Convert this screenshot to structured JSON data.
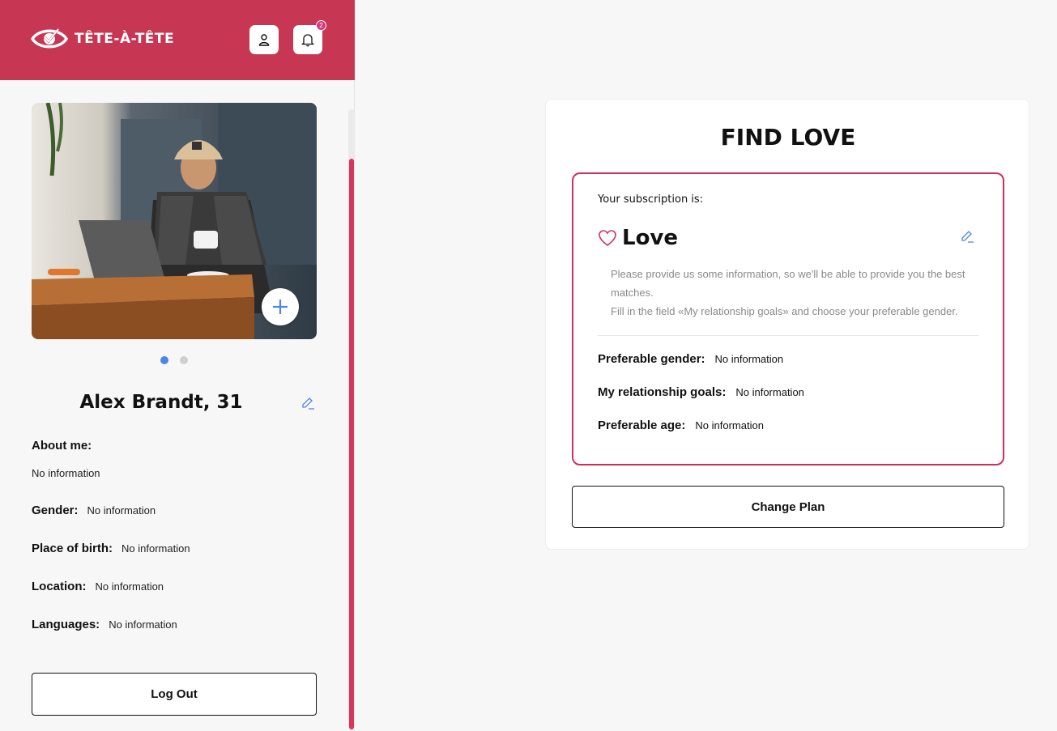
{
  "app": {
    "brand_name": "TÊTE-À-TÊTE",
    "notification_count": "2",
    "colors": {
      "brand": "#c73653",
      "accent_pink": "#cf2e5d",
      "link_blue": "#4b87e5"
    }
  },
  "profile": {
    "photo_count": 2,
    "active_photo_index": 0,
    "name": "Alex Brandt, 31",
    "about_label": "About me:",
    "about_value": "No information",
    "fields": [
      {
        "label": "Gender:",
        "value": "No information"
      },
      {
        "label": "Place of birth:",
        "value": "No information"
      },
      {
        "label": "Location:",
        "value": "No information"
      },
      {
        "label": "Languages:",
        "value": "No information"
      }
    ],
    "logout_label": "Log Out"
  },
  "find_love": {
    "title": "FIND LOVE",
    "subscription_label": "Your subscription is:",
    "plan_name": "Love",
    "description_line1": "Please provide us some information, so we'll be able to provide you the best matches.",
    "description_line2": "Fill in the field «My relationship goals» and choose your preferable gender.",
    "preferences": [
      {
        "label": "Preferable gender:",
        "value": "No information"
      },
      {
        "label": "My relationship goals:",
        "value": "No information"
      },
      {
        "label": "Preferable age:",
        "value": "No information"
      }
    ],
    "change_plan_label": "Change Plan"
  },
  "icons": [
    "eye-logo-icon",
    "user-icon",
    "bell-icon",
    "plus-icon",
    "pencil-icon",
    "heart-icon"
  ]
}
